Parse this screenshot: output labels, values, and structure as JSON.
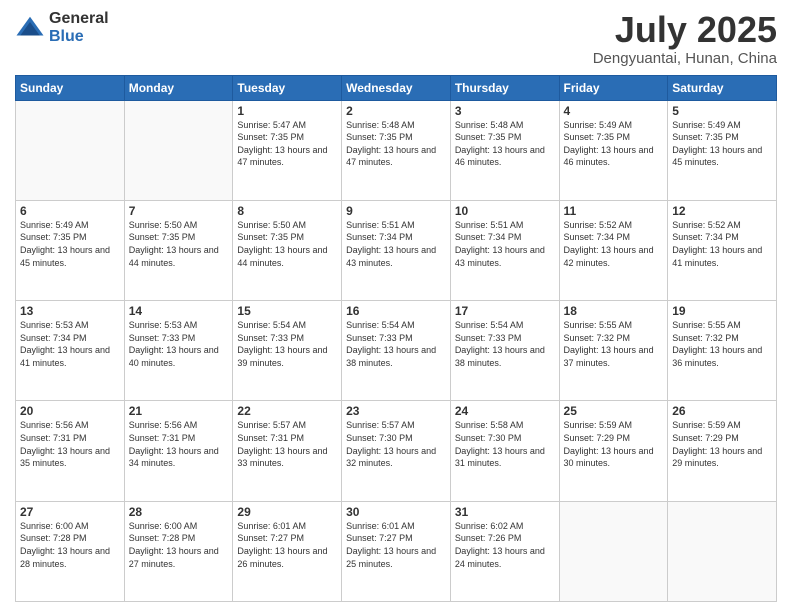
{
  "logo": {
    "general": "General",
    "blue": "Blue"
  },
  "title": {
    "month_year": "July 2025",
    "location": "Dengyuantai, Hunan, China"
  },
  "days_of_week": [
    "Sunday",
    "Monday",
    "Tuesday",
    "Wednesday",
    "Thursday",
    "Friday",
    "Saturday"
  ],
  "weeks": [
    [
      {
        "day": "",
        "info": ""
      },
      {
        "day": "",
        "info": ""
      },
      {
        "day": "1",
        "info": "Sunrise: 5:47 AM\nSunset: 7:35 PM\nDaylight: 13 hours and 47 minutes."
      },
      {
        "day": "2",
        "info": "Sunrise: 5:48 AM\nSunset: 7:35 PM\nDaylight: 13 hours and 47 minutes."
      },
      {
        "day": "3",
        "info": "Sunrise: 5:48 AM\nSunset: 7:35 PM\nDaylight: 13 hours and 46 minutes."
      },
      {
        "day": "4",
        "info": "Sunrise: 5:49 AM\nSunset: 7:35 PM\nDaylight: 13 hours and 46 minutes."
      },
      {
        "day": "5",
        "info": "Sunrise: 5:49 AM\nSunset: 7:35 PM\nDaylight: 13 hours and 45 minutes."
      }
    ],
    [
      {
        "day": "6",
        "info": "Sunrise: 5:49 AM\nSunset: 7:35 PM\nDaylight: 13 hours and 45 minutes."
      },
      {
        "day": "7",
        "info": "Sunrise: 5:50 AM\nSunset: 7:35 PM\nDaylight: 13 hours and 44 minutes."
      },
      {
        "day": "8",
        "info": "Sunrise: 5:50 AM\nSunset: 7:35 PM\nDaylight: 13 hours and 44 minutes."
      },
      {
        "day": "9",
        "info": "Sunrise: 5:51 AM\nSunset: 7:34 PM\nDaylight: 13 hours and 43 minutes."
      },
      {
        "day": "10",
        "info": "Sunrise: 5:51 AM\nSunset: 7:34 PM\nDaylight: 13 hours and 43 minutes."
      },
      {
        "day": "11",
        "info": "Sunrise: 5:52 AM\nSunset: 7:34 PM\nDaylight: 13 hours and 42 minutes."
      },
      {
        "day": "12",
        "info": "Sunrise: 5:52 AM\nSunset: 7:34 PM\nDaylight: 13 hours and 41 minutes."
      }
    ],
    [
      {
        "day": "13",
        "info": "Sunrise: 5:53 AM\nSunset: 7:34 PM\nDaylight: 13 hours and 41 minutes."
      },
      {
        "day": "14",
        "info": "Sunrise: 5:53 AM\nSunset: 7:33 PM\nDaylight: 13 hours and 40 minutes."
      },
      {
        "day": "15",
        "info": "Sunrise: 5:54 AM\nSunset: 7:33 PM\nDaylight: 13 hours and 39 minutes."
      },
      {
        "day": "16",
        "info": "Sunrise: 5:54 AM\nSunset: 7:33 PM\nDaylight: 13 hours and 38 minutes."
      },
      {
        "day": "17",
        "info": "Sunrise: 5:54 AM\nSunset: 7:33 PM\nDaylight: 13 hours and 38 minutes."
      },
      {
        "day": "18",
        "info": "Sunrise: 5:55 AM\nSunset: 7:32 PM\nDaylight: 13 hours and 37 minutes."
      },
      {
        "day": "19",
        "info": "Sunrise: 5:55 AM\nSunset: 7:32 PM\nDaylight: 13 hours and 36 minutes."
      }
    ],
    [
      {
        "day": "20",
        "info": "Sunrise: 5:56 AM\nSunset: 7:31 PM\nDaylight: 13 hours and 35 minutes."
      },
      {
        "day": "21",
        "info": "Sunrise: 5:56 AM\nSunset: 7:31 PM\nDaylight: 13 hours and 34 minutes."
      },
      {
        "day": "22",
        "info": "Sunrise: 5:57 AM\nSunset: 7:31 PM\nDaylight: 13 hours and 33 minutes."
      },
      {
        "day": "23",
        "info": "Sunrise: 5:57 AM\nSunset: 7:30 PM\nDaylight: 13 hours and 32 minutes."
      },
      {
        "day": "24",
        "info": "Sunrise: 5:58 AM\nSunset: 7:30 PM\nDaylight: 13 hours and 31 minutes."
      },
      {
        "day": "25",
        "info": "Sunrise: 5:59 AM\nSunset: 7:29 PM\nDaylight: 13 hours and 30 minutes."
      },
      {
        "day": "26",
        "info": "Sunrise: 5:59 AM\nSunset: 7:29 PM\nDaylight: 13 hours and 29 minutes."
      }
    ],
    [
      {
        "day": "27",
        "info": "Sunrise: 6:00 AM\nSunset: 7:28 PM\nDaylight: 13 hours and 28 minutes."
      },
      {
        "day": "28",
        "info": "Sunrise: 6:00 AM\nSunset: 7:28 PM\nDaylight: 13 hours and 27 minutes."
      },
      {
        "day": "29",
        "info": "Sunrise: 6:01 AM\nSunset: 7:27 PM\nDaylight: 13 hours and 26 minutes."
      },
      {
        "day": "30",
        "info": "Sunrise: 6:01 AM\nSunset: 7:27 PM\nDaylight: 13 hours and 25 minutes."
      },
      {
        "day": "31",
        "info": "Sunrise: 6:02 AM\nSunset: 7:26 PM\nDaylight: 13 hours and 24 minutes."
      },
      {
        "day": "",
        "info": ""
      },
      {
        "day": "",
        "info": ""
      }
    ]
  ]
}
